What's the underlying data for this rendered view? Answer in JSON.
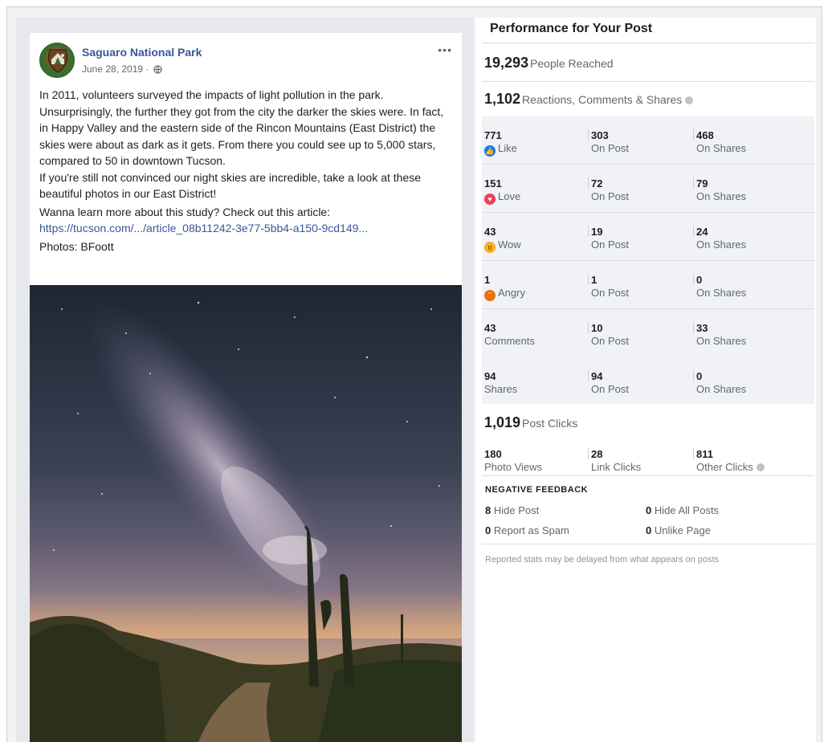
{
  "post": {
    "page_name": "Saguaro National Park",
    "date": "June 28, 2019 ·",
    "paragraphs": [
      "In 2011, volunteers surveyed the impacts of light pollution in the park. Unsurprisingly, the further they got from the city the darker the skies were. In fact, in Happy Valley and the eastern side of the Rincon Mountains (East District) the skies were about as dark as it gets. From there you could see up to 5,000 stars, compared to 50 in downtown Tucson.",
      "If you're still not convinced our night skies are incredible, take a look at these beautiful photos in our East District!",
      "Wanna learn more about this study? Check out this article:"
    ],
    "link": "https://tucson.com/.../article_08b11242-3e77-5bb4-a150-9cd149...",
    "photos_credit": "Photos: BFoott",
    "more": "•••"
  },
  "panel": {
    "title": "Performance for Your Post",
    "reached": {
      "value": "19,293",
      "label": "People Reached"
    },
    "engagement": {
      "value": "1,102",
      "label": "Reactions, Comments & Shares"
    },
    "rows": [
      {
        "icon": "like",
        "total": "771",
        "label": "Like",
        "on_post": "303",
        "on_shares": "468"
      },
      {
        "icon": "love",
        "total": "151",
        "label": "Love",
        "on_post": "72",
        "on_shares": "79"
      },
      {
        "icon": "wow",
        "total": "43",
        "label": "Wow",
        "on_post": "19",
        "on_shares": "24"
      },
      {
        "icon": "angry",
        "total": "1",
        "label": "Angry",
        "on_post": "1",
        "on_shares": "0"
      },
      {
        "icon": "",
        "total": "43",
        "label": "Comments",
        "on_post": "10",
        "on_shares": "33"
      },
      {
        "icon": "",
        "total": "94",
        "label": "Shares",
        "on_post": "94",
        "on_shares": "0"
      }
    ],
    "on_post_label": "On Post",
    "on_shares_label": "On Shares",
    "post_clicks": {
      "value": "1,019",
      "label": "Post Clicks"
    },
    "clicks": [
      {
        "value": "180",
        "label": "Photo Views"
      },
      {
        "value": "28",
        "label": "Link Clicks"
      },
      {
        "value": "811",
        "label": "Other Clicks"
      }
    ],
    "negative": {
      "title": "NEGATIVE FEEDBACK",
      "hide_post": {
        "value": "8",
        "label": "Hide Post"
      },
      "hide_all": {
        "value": "0",
        "label": "Hide All Posts"
      },
      "spam": {
        "value": "0",
        "label": "Report as Spam"
      },
      "unlike": {
        "value": "0",
        "label": "Unlike Page"
      }
    },
    "footnote": "Reported stats may be delayed from what appears on posts"
  }
}
